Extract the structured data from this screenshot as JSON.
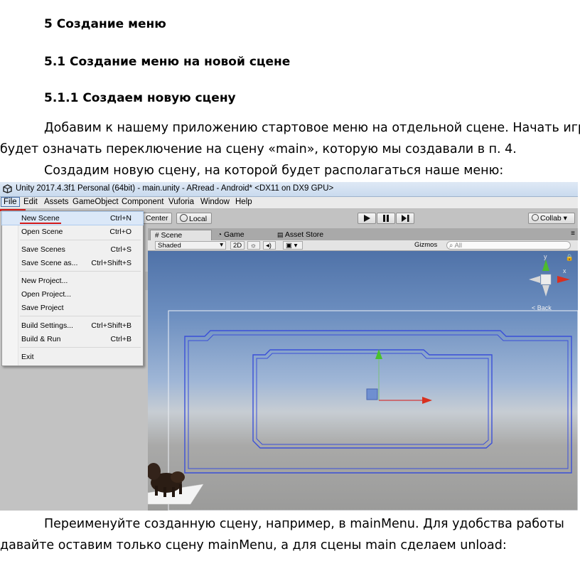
{
  "headings": {
    "h1": "5 Создание меню",
    "h2": "5.1 Создание меню на новой сцене",
    "h3": "5.1.1 Создаем новую сцену"
  },
  "paragraphs": {
    "p1_line1": "Добавим к нашему приложению стартовое меню на отдельной сцене. Начать игру",
    "p1_line2": "будет означать переключение на сцену «main», которую мы создавали в п. 4.",
    "p2": "Создадим новую сцену, на которой будет располагаться наше меню:",
    "p3_line1": "Переименуйте созданную сцену, например, в mainMenu. Для удобства работы",
    "p3_line2": "давайте оставим только сцену mainMenu, а для сцены main сделаем unload:"
  },
  "unity": {
    "window_title": "Unity 2017.4.3f1 Personal (64bit) - main.unity - ARread - Android* <DX11 on DX9 GPU>",
    "menu": [
      "File",
      "Edit",
      "Assets",
      "GameObject",
      "Component",
      "Vuforia",
      "Window",
      "Help"
    ],
    "file_menu": [
      {
        "label": "New Scene",
        "shortcut": "Ctrl+N"
      },
      {
        "label": "Open Scene",
        "shortcut": "Ctrl+O"
      },
      {
        "label": "Save Scenes",
        "shortcut": "Ctrl+S"
      },
      {
        "label": "Save Scene as...",
        "shortcut": "Ctrl+Shift+S"
      },
      {
        "label": "New Project...",
        "shortcut": ""
      },
      {
        "label": "Open Project...",
        "shortcut": ""
      },
      {
        "label": "Save Project",
        "shortcut": ""
      },
      {
        "label": "Build Settings...",
        "shortcut": "Ctrl+Shift+B"
      },
      {
        "label": "Build & Run",
        "shortcut": "Ctrl+B"
      },
      {
        "label": "Exit",
        "shortcut": ""
      }
    ],
    "toolbar": {
      "center": "Center",
      "local": "Local",
      "collab": "Collab ▾"
    },
    "tabs": [
      "Scene",
      "Game",
      "Asset Store"
    ],
    "scene_bar": {
      "shading": "Shaded",
      "mode_2d": "2D",
      "gizmos": "Gizmos ▾",
      "search_placeholder": "All"
    },
    "gizmo_label": "< Back",
    "axis_y": "y",
    "axis_x": "x"
  },
  "colors": {
    "highlight_red": "#d31a1a",
    "frame_blue": "#3a4fd8"
  }
}
